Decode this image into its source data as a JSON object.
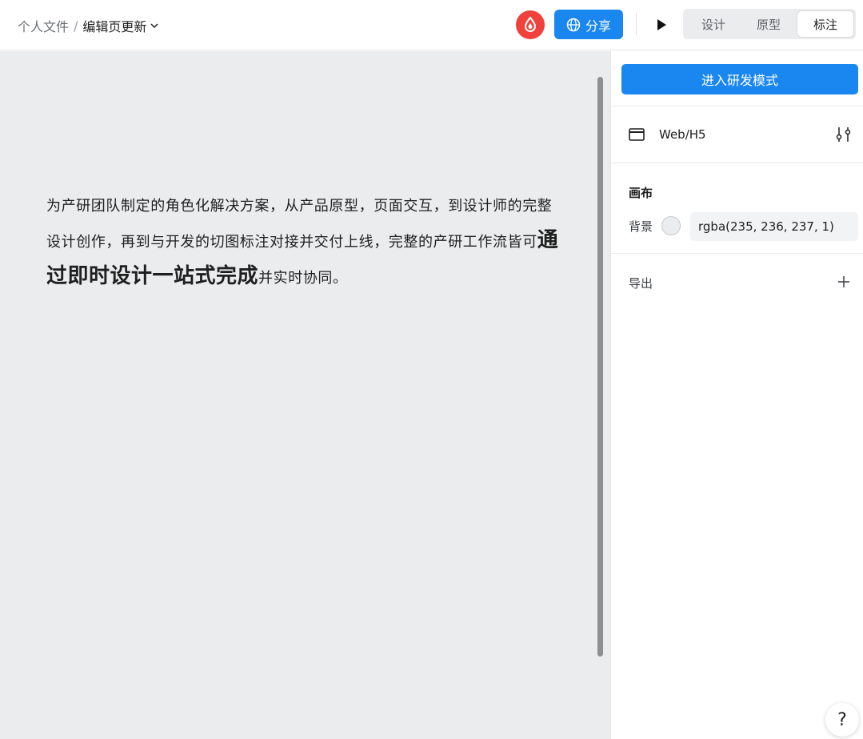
{
  "breadcrumb": {
    "parent": "个人文件",
    "separator": "/",
    "current": "编辑页更新"
  },
  "header": {
    "share_label": "分享",
    "modes": [
      "设计",
      "原型",
      "标注"
    ],
    "active_mode": "标注"
  },
  "canvas": {
    "text_before": "为产研团队制定的角色化解决方案，从产品原型，页面交互，到设计师的完整设计创作，再到与开发的切图标注对接并交付上线，完整的产研工作流皆可",
    "text_highlight": "通过即时设计一站式完成",
    "text_after": "并实时协同。",
    "background": "#ebecee"
  },
  "panel": {
    "dev_mode_label": "进入研发模式",
    "device_label": "Web/H5",
    "canvas_section_title": "画布",
    "background_label": "背景",
    "background_value": "rgba(235, 236, 237, 1)",
    "export_label": "导出"
  },
  "help": {
    "label": "?"
  },
  "colors": {
    "accent": "#1a86f0",
    "logo": "#f0413c"
  }
}
